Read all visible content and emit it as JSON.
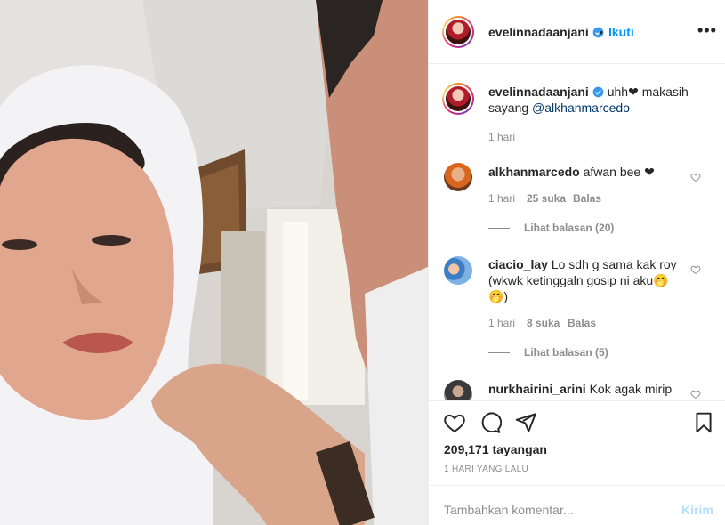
{
  "post": {
    "media_alt": "video"
  },
  "header": {
    "username": "evelinnadaanjani",
    "dot": "•",
    "follow_label": "Ikuti",
    "more_label": "•••"
  },
  "caption": {
    "username": "evelinnadaanjani",
    "text_before": "uhh❤ makasih sayang ",
    "mention": "@alkhanmarcedo",
    "time": "1 hari"
  },
  "comments": [
    {
      "username": "alkhanmarcedo",
      "text": "afwan bee ❤",
      "time": "1 hari",
      "likes": "25 suka",
      "reply_label": "Balas",
      "view_replies": "Lihat balasan (20)"
    },
    {
      "username": "ciacio_lay",
      "text": "Lo sdh g sama kak roy (wkwk ketinggaln gosip ni aku🤭🤭)",
      "time": "1 hari",
      "likes": "8 suka",
      "reply_label": "Balas",
      "view_replies": "Lihat balasan (5)"
    },
    {
      "username": "nurkhairini_arini",
      "text": "Kok agak mirip"
    }
  ],
  "stats": {
    "views_count": "209,171",
    "views_label": "tayangan",
    "posted": "1 HARI YANG LALU"
  },
  "add_comment": {
    "placeholder": "Tambahkan komentar...",
    "send_label": "Kirim"
  },
  "colors": {
    "accent": "#0095f6",
    "muted": "#8e8e8e",
    "border": "#efefef"
  }
}
